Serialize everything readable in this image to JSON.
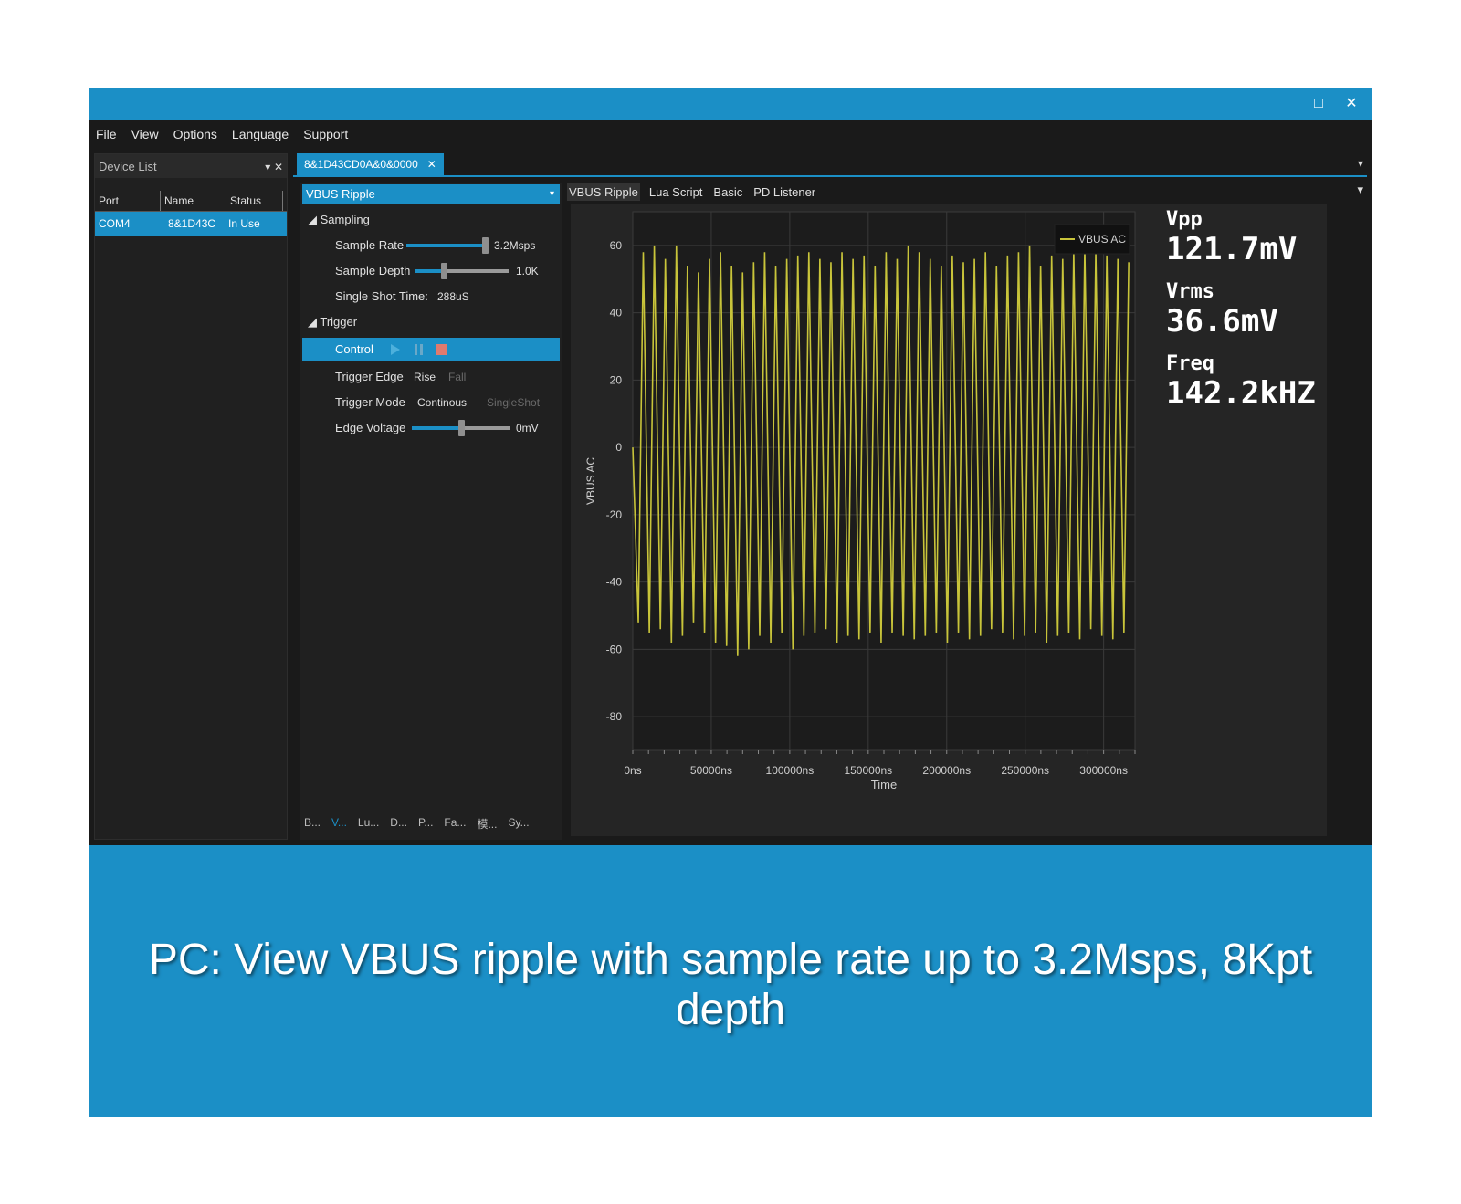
{
  "window": {
    "controls": [
      "_",
      "□",
      "✕"
    ]
  },
  "menu": [
    "File",
    "View",
    "Options",
    "Language",
    "Support"
  ],
  "device_list": {
    "title": "Device List",
    "pin": "▾",
    "close": "✕",
    "columns": [
      "Port",
      "Name",
      "Status"
    ],
    "rows": [
      {
        "port": "COM4",
        "name": "8&1D43C",
        "status": "In Use"
      }
    ]
  },
  "doc_tab": {
    "label": "8&1D43CD0A&0&0000",
    "close": "✕",
    "menu": "▾"
  },
  "settings": {
    "combo": "VBUS Ripple",
    "combo_arrow": "▾",
    "sampling": {
      "header": "◢ Sampling",
      "sample_rate_label": "Sample Rate",
      "sample_rate_value": "3.2Msps",
      "sample_rate_fraction": 1.0,
      "sample_depth_label": "Sample Depth",
      "sample_depth_value": "1.0K",
      "sample_depth_fraction": 0.3,
      "single_shot_label": "Single Shot Time:",
      "single_shot_value": "288uS"
    },
    "trigger": {
      "header": "◢ Trigger",
      "control_label": "Control",
      "edge_label": "Trigger Edge",
      "edge_rise": "Rise",
      "edge_fall": "Fall",
      "mode_label": "Trigger Mode",
      "mode_cont": "Continous",
      "mode_single": "SingleShot",
      "voltage_label": "Edge Voltage",
      "voltage_value": "0mV",
      "voltage_fraction": 0.5
    },
    "bottom_tabs": [
      "B...",
      "V...",
      "Lu...",
      "D...",
      "P...",
      "Fa...",
      "模...",
      "Sy..."
    ]
  },
  "sub_tabs": [
    "VBUS Ripple",
    "Lua Script",
    "Basic",
    "PD Listener"
  ],
  "sub_menu": "▾",
  "stats": [
    {
      "label": "Vpp",
      "value": "121.7mV"
    },
    {
      "label": "Vrms",
      "value": "36.6mV"
    },
    {
      "label": "Freq",
      "value": "142.2kHZ"
    }
  ],
  "chart_data": {
    "type": "line",
    "xlabel": "Time",
    "ylabel": "VBUS AC",
    "xlim": [
      0,
      320000
    ],
    "ylim": [
      -90,
      70
    ],
    "x_ticks": [
      "0ns",
      "50000ns",
      "100000ns",
      "150000ns",
      "200000ns",
      "250000ns",
      "300000ns"
    ],
    "x_tick_values": [
      0,
      50000,
      100000,
      150000,
      200000,
      250000,
      300000
    ],
    "y_ticks": [
      60,
      40,
      20,
      0,
      -20,
      -40,
      -60,
      -80
    ],
    "grid": true,
    "legend_position": "top-right",
    "series": [
      {
        "name": "VBUS AC",
        "color": "#c8c43a",
        "frequency_hz": 142200,
        "x_end": 316000,
        "peaks": [
          58,
          60,
          56,
          60,
          54,
          52,
          56,
          58,
          54,
          52,
          55,
          58,
          54,
          56,
          57,
          58,
          56,
          55,
          58,
          56,
          57,
          54,
          58,
          56,
          60,
          58,
          56,
          54,
          57,
          55,
          56,
          58,
          54,
          57,
          58,
          60,
          54,
          57,
          56,
          58,
          59,
          58,
          57,
          56,
          55
        ],
        "troughs": [
          -52,
          -55,
          -54,
          -58,
          -56,
          -52,
          -55,
          -58,
          -59,
          -62,
          -60,
          -56,
          -58,
          -55,
          -60,
          -56,
          -55,
          -54,
          -58,
          -56,
          -57,
          -55,
          -58,
          -55,
          -56,
          -57,
          -56,
          -55,
          -58,
          -55,
          -57,
          -56,
          -54,
          -55,
          -57,
          -56,
          -55,
          -58,
          -56,
          -55,
          -57,
          -54,
          -56,
          -57,
          -55
        ]
      }
    ]
  },
  "caption": "PC: View VBUS ripple with sample rate up to 3.2Msps, 8Kpt depth"
}
